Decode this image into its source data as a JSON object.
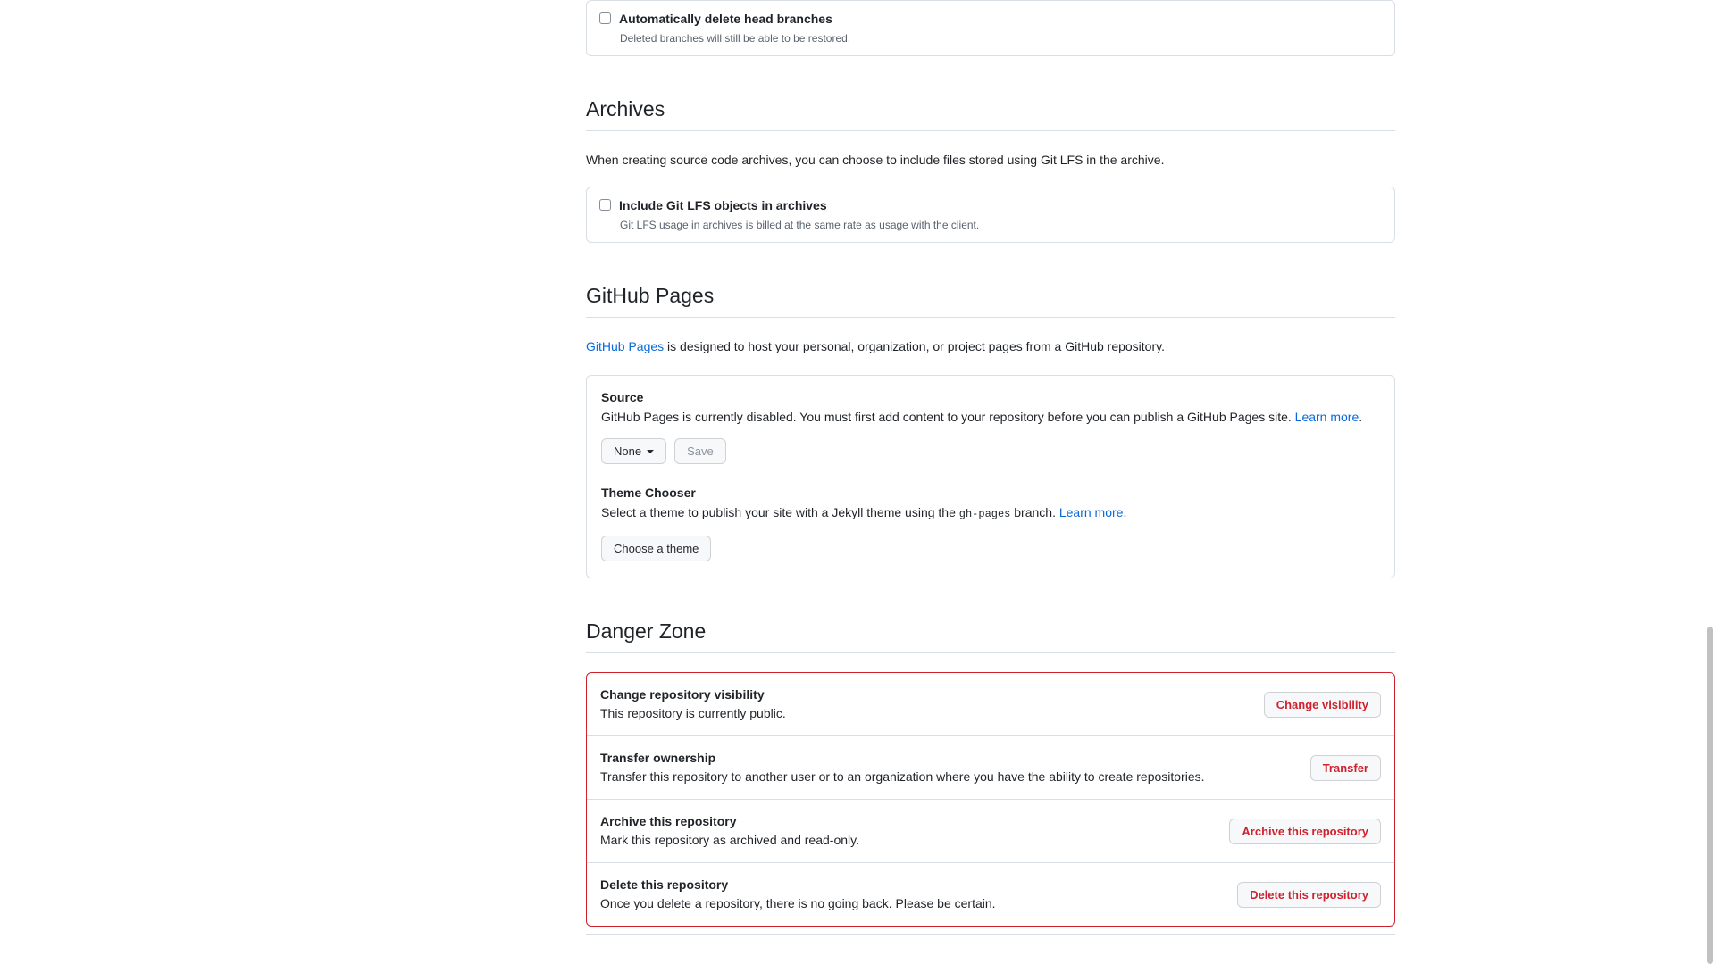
{
  "auto_delete": {
    "title": "Automatically delete head branches",
    "description": "Deleted branches will still be able to be restored."
  },
  "archives": {
    "heading": "Archives",
    "description": "When creating source code archives, you can choose to include files stored using Git LFS in the archive.",
    "checkbox": {
      "title": "Include Git LFS objects in archives",
      "description": "Git LFS usage in archives is billed at the same rate as usage with the client."
    }
  },
  "github_pages": {
    "heading": "GitHub Pages",
    "intro_link": "GitHub Pages",
    "intro_rest": " is designed to host your personal, organization, or project pages from a GitHub repository.",
    "source": {
      "title": "Source",
      "description": "GitHub Pages is currently disabled. You must first add content to your repository before you can publish a GitHub Pages site.",
      "learn_more": "Learn more",
      "period": ".",
      "branch_select": "None",
      "save_label": "Save"
    },
    "theme": {
      "title": "Theme Chooser",
      "desc_before": "Select a theme to publish your site with a Jekyll theme using the ",
      "branch_code": "gh-pages",
      "desc_after": " branch. ",
      "learn_more": "Learn more",
      "period": ".",
      "choose_label": "Choose a theme"
    }
  },
  "danger_zone": {
    "heading": "Danger Zone",
    "rows": [
      {
        "title": "Change repository visibility",
        "description": "This repository is currently public.",
        "button": "Change visibility"
      },
      {
        "title": "Transfer ownership",
        "description": "Transfer this repository to another user or to an organization where you have the ability to create repositories.",
        "button": "Transfer"
      },
      {
        "title": "Archive this repository",
        "description": "Mark this repository as archived and read-only.",
        "button": "Archive this repository"
      },
      {
        "title": "Delete this repository",
        "description": "Once you delete a repository, there is no going back. Please be certain.",
        "button": "Delete this repository"
      }
    ]
  },
  "colors": {
    "link": "#0969da",
    "danger": "#cf222e",
    "border": "#d8dee4",
    "muted_text": "#59636e"
  }
}
